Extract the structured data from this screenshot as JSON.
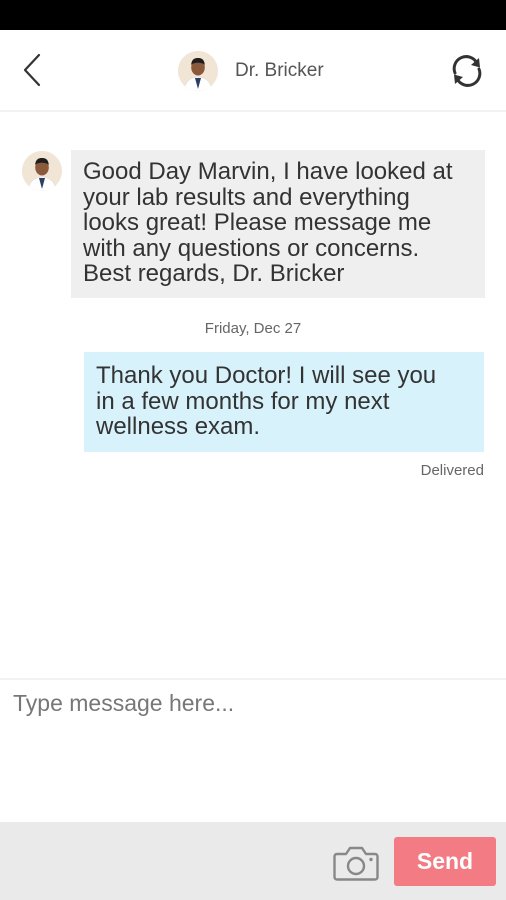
{
  "header": {
    "contact_name": "Dr. Bricker",
    "back_icon": "chevron-left-icon",
    "refresh_icon": "refresh-icon"
  },
  "messages": [
    {
      "direction": "incoming",
      "lines": [
        "Good Day Marvin, I have looked at",
        "your lab results and everything",
        "looks great! Please message me",
        "with any questions or concerns.",
        "Best regards, Dr. Bricker"
      ]
    },
    {
      "direction": "outgoing",
      "date_label": "Friday, Dec 27",
      "lines": [
        "Thank you Doctor! I will see you",
        "in a few months for my next",
        "wellness exam."
      ],
      "status": "Delivered"
    }
  ],
  "composer": {
    "placeholder": "Type message here...",
    "value": ""
  },
  "actions": {
    "camera_icon": "camera-icon",
    "send_label": "Send"
  },
  "colors": {
    "incoming_bubble": "#efefef",
    "outgoing_bubble": "#d7f2fb",
    "send_button": "#f27b84",
    "bottom_bar": "#eaeaea"
  }
}
